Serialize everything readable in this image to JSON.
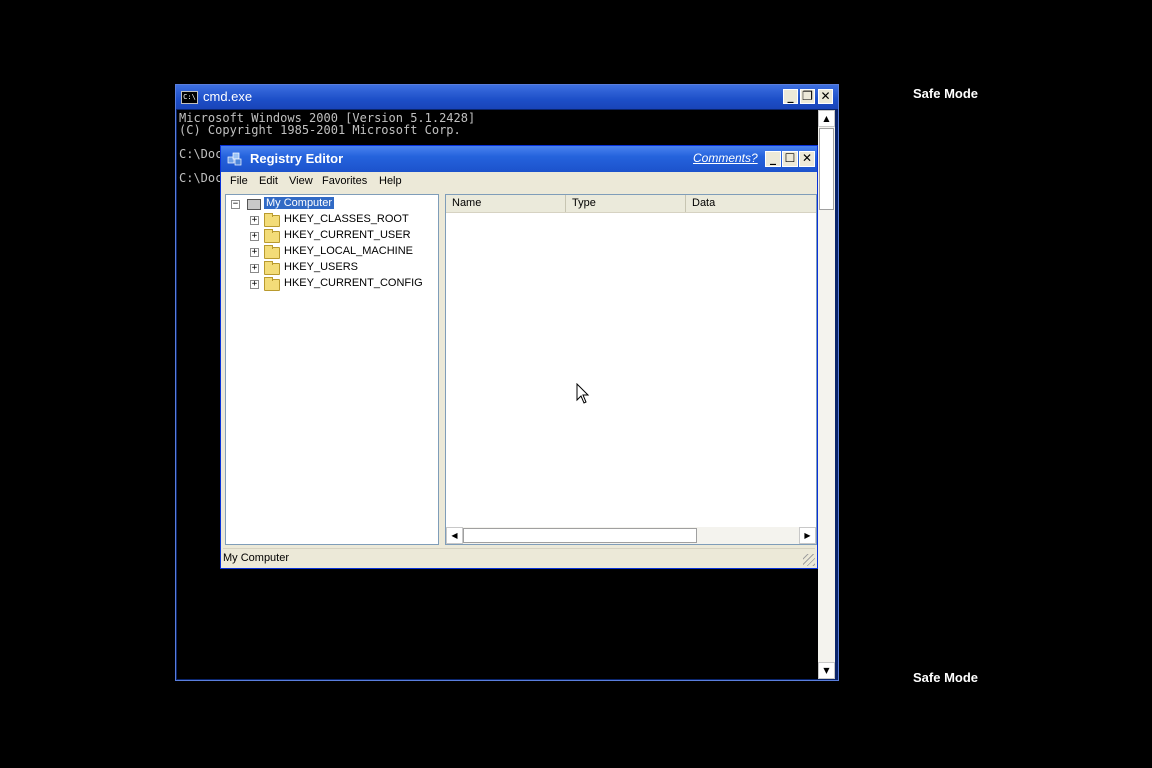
{
  "safe_mode": {
    "top_label": "Safe Mode",
    "bottom_label": "Safe Mode"
  },
  "cmd": {
    "title": "cmd.exe",
    "icon_text": "C:\\",
    "lines": [
      "Microsoft Windows 2000 [Version 5.1.2428]",
      "(C) Copyright 1985-2001 Microsoft Corp.",
      "",
      "C:\\Doc",
      "",
      "C:\\Doc"
    ],
    "controls": {
      "minimize": "_",
      "restore": "❐",
      "close": "✕"
    },
    "scroll": {
      "up": "▲",
      "down": "▼"
    }
  },
  "registry": {
    "title": "Registry Editor",
    "comments_link": "Comments?",
    "controls": {
      "minimize": "_",
      "maximize": "☐",
      "close": "✕"
    },
    "menu": [
      "File",
      "Edit",
      "View",
      "Favorites",
      "Help"
    ],
    "tree": {
      "root": {
        "label": "My Computer",
        "expander": "−",
        "icon": "computer-icon",
        "selected": true
      },
      "keys": [
        {
          "label": "HKEY_CLASSES_ROOT",
          "expander": "+",
          "icon": "folder-icon"
        },
        {
          "label": "HKEY_CURRENT_USER",
          "expander": "+",
          "icon": "folder-icon"
        },
        {
          "label": "HKEY_LOCAL_MACHINE",
          "expander": "+",
          "icon": "folder-icon"
        },
        {
          "label": "HKEY_USERS",
          "expander": "+",
          "icon": "folder-icon"
        },
        {
          "label": "HKEY_CURRENT_CONFIG",
          "expander": "+",
          "icon": "folder-icon"
        }
      ]
    },
    "columns": [
      "Name",
      "Type",
      "Data"
    ],
    "hscroll": {
      "left": "◀",
      "right": "▶"
    },
    "status": "My Computer"
  },
  "colors": {
    "xp_title_blue": "#2563dc",
    "selection_blue": "#316ac5",
    "window_face": "#ece9d8",
    "folder_yellow": "#f3dc78"
  }
}
